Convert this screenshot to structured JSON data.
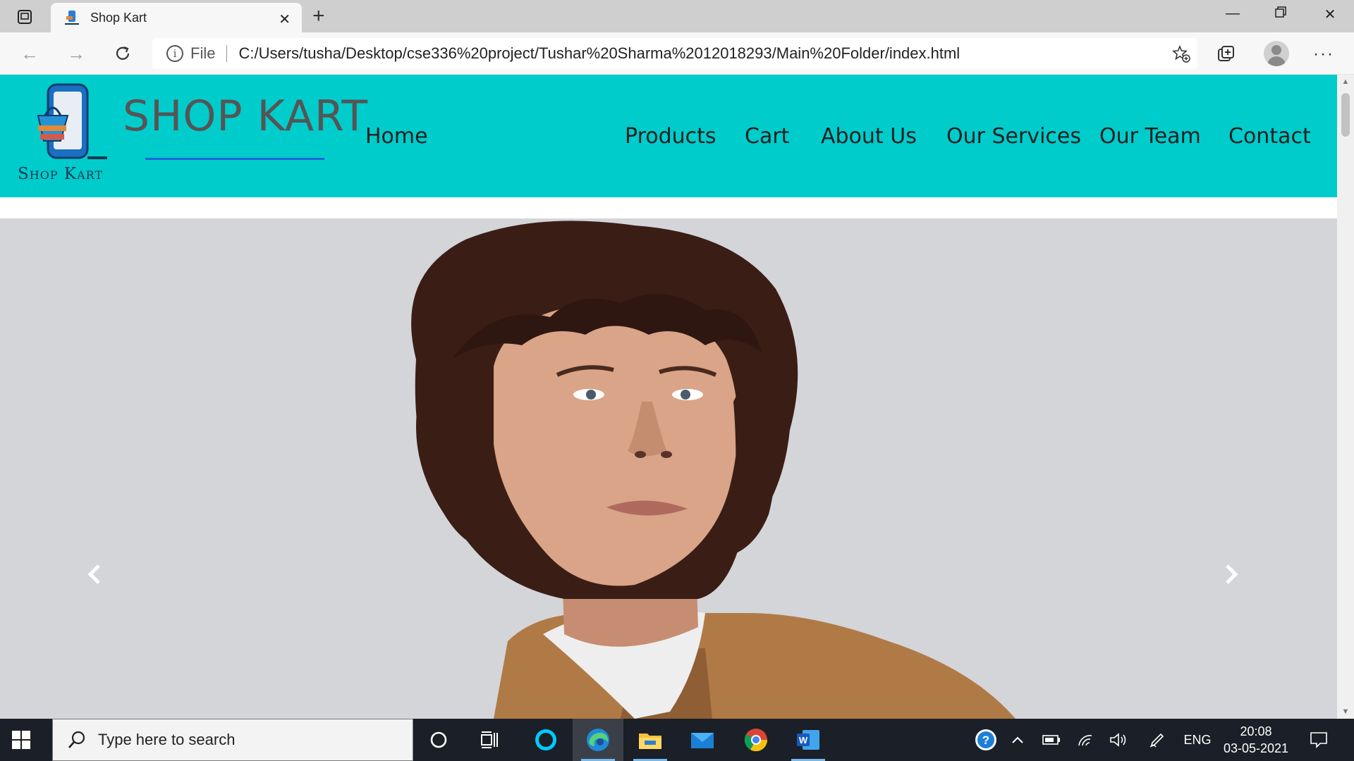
{
  "browser": {
    "tab_title": "Shop Kart",
    "address_scheme": "File",
    "address_url": "C:/Users/tusha/Desktop/cse336%20project/Tushar%20Sharma%2012018293/Main%20Folder/index.html"
  },
  "site": {
    "logo_text": "Shop Kart",
    "brand": "SHOP KART",
    "nav": [
      "Home",
      "Products",
      "Cart",
      "About Us",
      "Our Services",
      "Our Team",
      "Contact"
    ]
  },
  "hero": {
    "image_subject": "portrait of curly-haired woman in tan jacket",
    "background_color": "#d4d5d9"
  },
  "taskbar": {
    "search_placeholder": "Type here to search",
    "language": "ENG",
    "time": "20:08",
    "date": "03-05-2021"
  },
  "colors": {
    "header": "#00cccc",
    "brand_underline": "#1e66d9",
    "taskbar": "#1b1f27"
  }
}
